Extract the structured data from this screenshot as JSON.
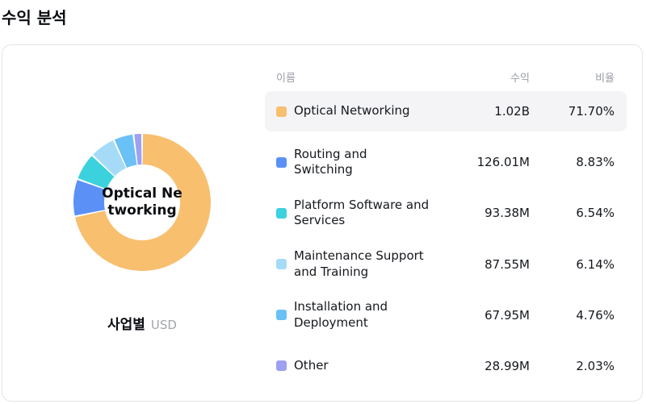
{
  "page": {
    "title": "수익 분석"
  },
  "table": {
    "headers": {
      "name": "이름",
      "revenue": "수익",
      "ratio": "비율"
    },
    "rows": [
      {
        "name": "Optical Networking",
        "revenue": "1.02B",
        "ratio": "71.70%",
        "color": "#F8BF6F",
        "highlighted": true
      },
      {
        "name": "Routing and Switching",
        "revenue": "126.01M",
        "ratio": "8.83%",
        "color": "#5B91F7",
        "highlighted": false
      },
      {
        "name": "Platform Software and Services",
        "revenue": "93.38M",
        "ratio": "6.54%",
        "color": "#3BD2DE",
        "highlighted": false
      },
      {
        "name": "Maintenance Support and Training",
        "revenue": "87.55M",
        "ratio": "6.14%",
        "color": "#A6DBF8",
        "highlighted": false
      },
      {
        "name": "Installation and Deployment",
        "revenue": "67.95M",
        "ratio": "4.76%",
        "color": "#6AC1F6",
        "highlighted": false
      },
      {
        "name": "Other",
        "revenue": "28.99M",
        "ratio": "2.03%",
        "color": "#9EA0F2",
        "highlighted": false
      }
    ]
  },
  "chart": {
    "center_label": "Optical Ne\ntworking",
    "caption": {
      "label": "사업별",
      "unit": "USD"
    }
  },
  "chart_data": {
    "type": "pie",
    "title": "수익 분석",
    "categories": [
      "Optical Networking",
      "Routing and Switching",
      "Platform Software and Services",
      "Maintenance Support and Training",
      "Installation and Deployment",
      "Other"
    ],
    "values": [
      71.7,
      8.83,
      6.54,
      6.14,
      4.76,
      2.03
    ],
    "revenue_labels": [
      "1.02B",
      "126.01M",
      "93.38M",
      "87.55M",
      "67.95M",
      "28.99M"
    ],
    "colors": [
      "#F8BF6F",
      "#5B91F7",
      "#3BD2DE",
      "#A6DBF8",
      "#6AC1F6",
      "#9EA0F2"
    ],
    "unit": "USD",
    "group_by": "사업별",
    "donut": true,
    "inner_radius_ratio": 0.55,
    "start_angle_deg": 0,
    "legend_position": "right-table"
  }
}
